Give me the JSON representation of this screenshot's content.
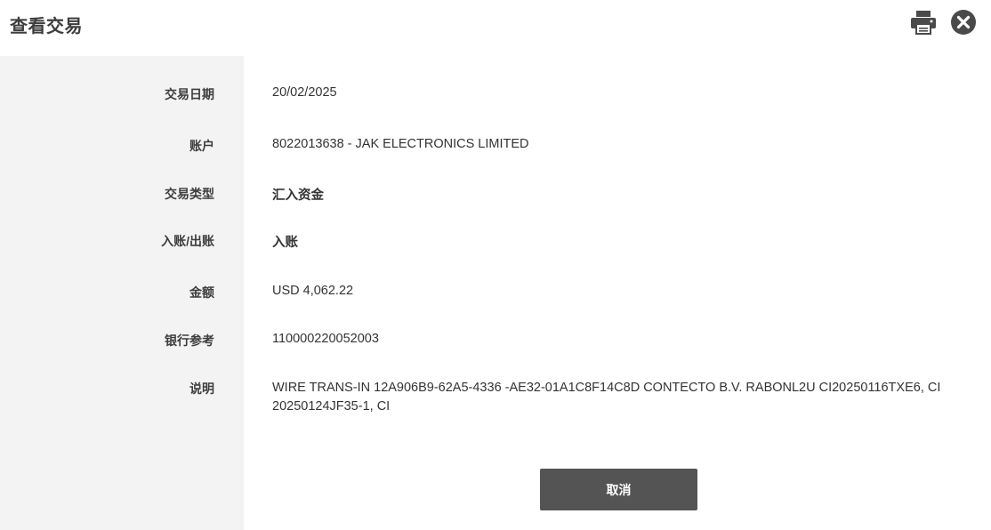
{
  "dialog": {
    "title": "查看交易"
  },
  "fields": [
    {
      "label": "交易日期",
      "value": "20/02/2025"
    },
    {
      "label": "账户",
      "value": "8022013638 - JAK ELECTRONICS LIMITED"
    },
    {
      "label": "交易类型",
      "value": "汇入资金"
    },
    {
      "label": "入账/出账",
      "value": "入账"
    },
    {
      "label": "金额",
      "value": "USD 4,062.22"
    },
    {
      "label": "银行参考",
      "value": "110000220052003"
    },
    {
      "label": "说明",
      "value": "WIRE TRANS-IN 12A906B9-62A5-4336 -AE32-01A1C8F14C8D CONTECTO B.V. RABONL2U CI20250116TXE6, CI 20250124JF35-1, CI"
    }
  ],
  "actions": {
    "cancel_label": "取消"
  },
  "icons": {
    "print": "print-icon",
    "close": "close-icon"
  },
  "colors": {
    "label_bg": "#f3f3f3",
    "button_bg": "#545454",
    "icon": "#4a4a4a"
  }
}
